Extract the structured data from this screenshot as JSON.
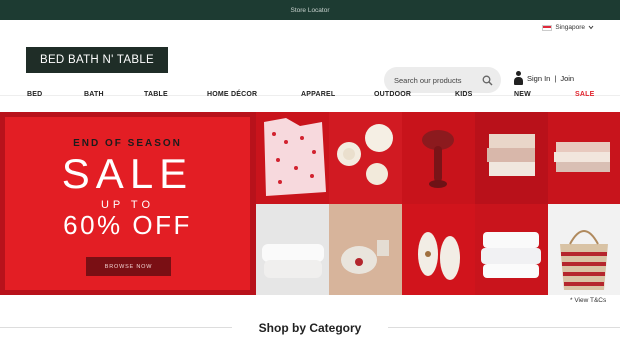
{
  "topbar": {
    "store_locator": "Store Locator"
  },
  "header": {
    "region": "Singapore",
    "logo": "BED BATH N' TABLE",
    "search_placeholder": "Search our products",
    "signin": "Sign In",
    "separator": "|",
    "join": "Join"
  },
  "nav": {
    "items": [
      "BED",
      "BATH",
      "TABLE",
      "HOME DÉCOR",
      "APPAREL",
      "OUTDOOR",
      "KIDS",
      "NEW",
      "SALE"
    ],
    "sale_color": "#e0222c"
  },
  "hero": {
    "eyebrow": "END OF SEASON",
    "headline": "SALE",
    "upto": "UP TO",
    "discount": "60% OFF",
    "cta": "BROWSE NOW",
    "terms": "* View T&Cs",
    "accent": "#e31e24"
  },
  "section": {
    "title": "Shop by Category"
  }
}
